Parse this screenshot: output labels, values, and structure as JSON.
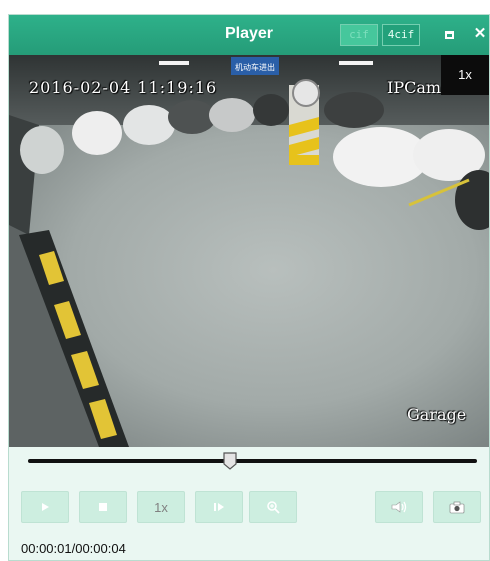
{
  "window": {
    "title": "Player",
    "resolution_buttons": [
      "cif",
      "4cif"
    ],
    "active_resolution": "4cif"
  },
  "video": {
    "osd_timestamp": "2016-02-04 11:19:16",
    "osd_camera": "IPCam",
    "osd_location": "Garage",
    "sign_text": "机动车进出",
    "speed_badge": "1x"
  },
  "playback": {
    "progress": 0.45,
    "speed_label": "1x",
    "timecode": "00:00:01/00:00:04"
  },
  "icons": [
    "play-icon",
    "stop-icon",
    "step-frame-icon",
    "zoom-icon",
    "audio-icon",
    "capture-icon",
    "maximize-icon",
    "close-icon"
  ],
  "colors": {
    "titlebar": "#259c78",
    "panel": "#eaf7f2",
    "button": "#cdeee0"
  }
}
